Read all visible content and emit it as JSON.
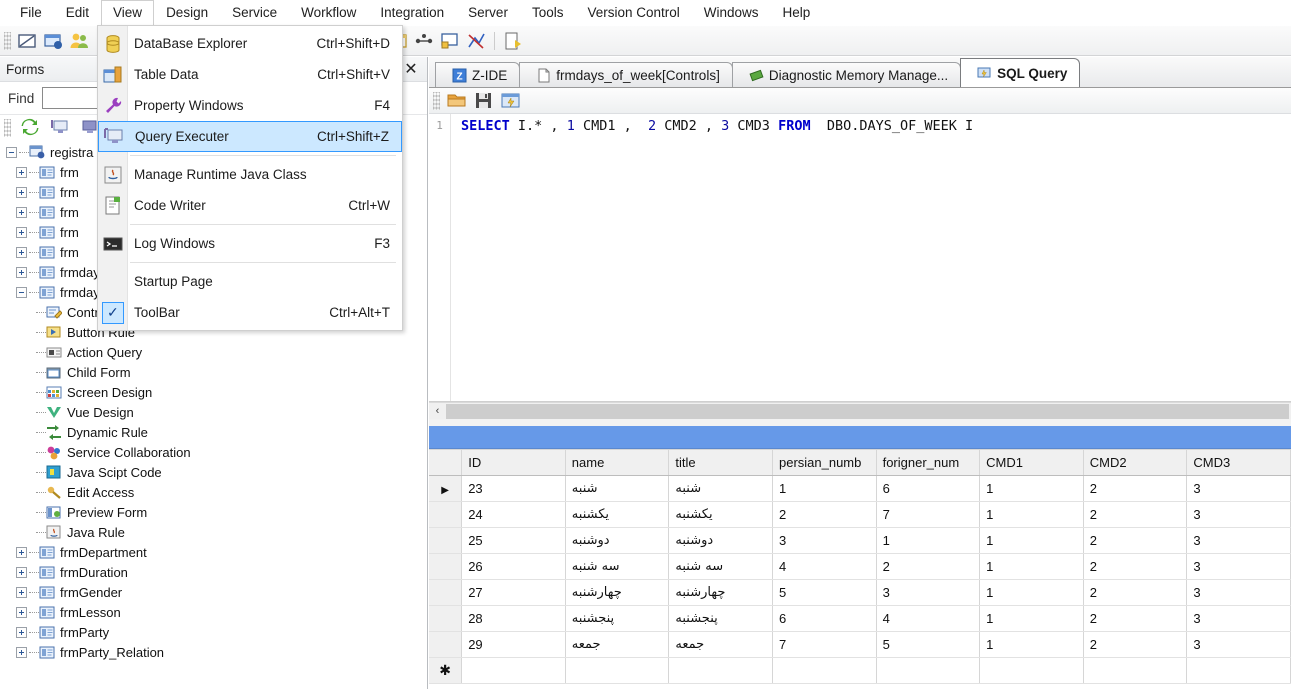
{
  "menubar": {
    "items": [
      {
        "label": "File",
        "open": false
      },
      {
        "label": "Edit",
        "open": false
      },
      {
        "label": "View",
        "open": true
      },
      {
        "label": "Design",
        "open": false
      },
      {
        "label": "Service",
        "open": false
      },
      {
        "label": "Workflow",
        "open": false
      },
      {
        "label": "Integration",
        "open": false
      },
      {
        "label": "Server",
        "open": false
      },
      {
        "label": "Tools",
        "open": false
      },
      {
        "label": "Version Control",
        "open": false
      },
      {
        "label": "Windows",
        "open": false
      },
      {
        "label": "Help",
        "open": false
      }
    ]
  },
  "view_menu": {
    "items": [
      {
        "label": "DataBase Explorer",
        "shortcut": "Ctrl+Shift+D",
        "icon": "database-cylinder-icon",
        "selected": false,
        "separator_after": false
      },
      {
        "label": "Table Data",
        "shortcut": "Ctrl+Shift+V",
        "icon": "table-data-icon",
        "selected": false,
        "separator_after": false
      },
      {
        "label": "Property Windows",
        "shortcut": "F4",
        "icon": "wrench-icon",
        "selected": false,
        "separator_after": false
      },
      {
        "label": "Query Executer",
        "shortcut": "Ctrl+Shift+Z",
        "icon": "query-executer-icon",
        "selected": true,
        "separator_after": true
      },
      {
        "label": "Manage Runtime Java Class",
        "shortcut": "",
        "icon": "java-class-icon",
        "selected": false,
        "separator_after": false
      },
      {
        "label": "Code Writer",
        "shortcut": "Ctrl+W",
        "icon": "code-writer-icon",
        "selected": false,
        "separator_after": true
      },
      {
        "label": "Log Windows",
        "shortcut": "F3",
        "icon": "console-icon",
        "selected": false,
        "separator_after": true
      },
      {
        "label": "Startup Page",
        "shortcut": "",
        "icon": "",
        "selected": false,
        "separator_after": false
      },
      {
        "label": "ToolBar",
        "shortcut": "Ctrl+Alt+T",
        "icon": "checkmark-icon",
        "selected": false,
        "separator_after": false
      }
    ]
  },
  "left_panel": {
    "caption": "Forms",
    "close_label": "✕",
    "find_label": "Find",
    "find_value": "",
    "find_placeholder": "",
    "toolbar_icons": [
      "refresh-icon",
      "query-executer-icon",
      "screen-icon"
    ],
    "tree": {
      "root": {
        "label": "registra",
        "icon": "project-icon",
        "expanded": true
      },
      "children": [
        {
          "label": "frm",
          "icon": "form-icon",
          "expanded": false,
          "depth": 1
        },
        {
          "label": "frm",
          "icon": "form-icon",
          "expanded": false,
          "depth": 1
        },
        {
          "label": "frm",
          "icon": "form-icon",
          "expanded": false,
          "depth": 1
        },
        {
          "label": "frm",
          "icon": "form-icon",
          "expanded": false,
          "depth": 1
        },
        {
          "label": "frm",
          "icon": "form-icon",
          "expanded": false,
          "depth": 1
        },
        {
          "label": "frmdays_of_week",
          "icon": "form-icon",
          "expanded": false,
          "depth": 1
        },
        {
          "label": "frmdays_of_week",
          "icon": "form-icon",
          "expanded": true,
          "depth": 1
        },
        {
          "label": "Controls",
          "icon": "controls-icon",
          "leaf": true,
          "depth": 2
        },
        {
          "label": "Button Rule",
          "icon": "button-rule-icon",
          "leaf": true,
          "depth": 2
        },
        {
          "label": "Action Query",
          "icon": "action-query-icon",
          "leaf": true,
          "depth": 2
        },
        {
          "label": "Child Form",
          "icon": "child-form-icon",
          "leaf": true,
          "depth": 2
        },
        {
          "label": "Screen Design",
          "icon": "screen-design-icon",
          "leaf": true,
          "depth": 2
        },
        {
          "label": "Vue Design",
          "icon": "vue-design-icon",
          "leaf": true,
          "depth": 2
        },
        {
          "label": "Dynamic Rule",
          "icon": "dynamic-rule-icon",
          "leaf": true,
          "depth": 2
        },
        {
          "label": "Service Collaboration",
          "icon": "service-collaboration-icon",
          "leaf": true,
          "depth": 2
        },
        {
          "label": "Java Scipt Code",
          "icon": "java-script-icon",
          "leaf": true,
          "depth": 2
        },
        {
          "label": "Edit Access",
          "icon": "edit-access-icon",
          "leaf": true,
          "depth": 2
        },
        {
          "label": "Preview Form",
          "icon": "preview-form-icon",
          "leaf": true,
          "depth": 2
        },
        {
          "label": "Java Rule",
          "icon": "java-rule-icon",
          "leaf": true,
          "depth": 2
        },
        {
          "label": "frmDepartment",
          "icon": "form-icon",
          "expanded": false,
          "depth": 1
        },
        {
          "label": "frmDuration",
          "icon": "form-icon",
          "expanded": false,
          "depth": 1
        },
        {
          "label": "frmGender",
          "icon": "form-icon",
          "expanded": false,
          "depth": 1
        },
        {
          "label": "frmLesson",
          "icon": "form-icon",
          "expanded": false,
          "depth": 1
        },
        {
          "label": "frmParty",
          "icon": "form-icon",
          "expanded": false,
          "depth": 1
        },
        {
          "label": "frmParty_Relation",
          "icon": "form-icon",
          "expanded": false,
          "depth": 1
        }
      ]
    }
  },
  "editor": {
    "tabs": [
      {
        "label": "Z-IDE",
        "icon": "z-ide-icon",
        "active": false
      },
      {
        "label": "frmdays_of_week[Controls]",
        "icon": "document-icon",
        "active": false
      },
      {
        "label": "Diagnostic Memory Manage...",
        "icon": "memory-icon",
        "active": false
      },
      {
        "label": "SQL Query",
        "icon": "sql-query-icon",
        "active": true
      }
    ],
    "sql_toolbar": [
      "open-folder-icon",
      "save-icon",
      "execute-query-icon"
    ],
    "code": {
      "line_number": "1",
      "tokens": [
        {
          "text": "SELECT",
          "type": "keyword"
        },
        {
          "text": " I.* , ",
          "type": "plain"
        },
        {
          "text": "1",
          "type": "number"
        },
        {
          "text": " CMD1 ,  ",
          "type": "plain"
        },
        {
          "text": "2",
          "type": "number"
        },
        {
          "text": " CMD2 , ",
          "type": "plain"
        },
        {
          "text": "3",
          "type": "number"
        },
        {
          "text": " CMD3 ",
          "type": "plain"
        },
        {
          "text": "FROM",
          "type": "keyword"
        },
        {
          "text": "  DBO.DAYS_OF_WEEK I",
          "type": "plain"
        }
      ],
      "full_text": "SELECT I.* , 1 CMD1 ,  2 CMD2 , 3 CMD3 FROM  DBO.DAYS_OF_WEEK I"
    },
    "scroll_left_arrow": "‹"
  },
  "grid": {
    "columns": [
      "ID",
      "name",
      "title",
      "persian_numb",
      "forigner_num",
      "CMD1",
      "CMD2",
      "CMD3"
    ],
    "selected_row_marker": "▶",
    "new_row_marker": "✱",
    "rows": [
      {
        "selected": true,
        "ID": "23",
        "name": "شنبه",
        "title": "شنبه",
        "persian_numb": "1",
        "forigner_num": "6",
        "CMD1": "1",
        "CMD2": "2",
        "CMD3": "3"
      },
      {
        "selected": false,
        "ID": "24",
        "name": "یکشنبه",
        "title": "یکشنبه",
        "persian_numb": "2",
        "forigner_num": "7",
        "CMD1": "1",
        "CMD2": "2",
        "CMD3": "3"
      },
      {
        "selected": false,
        "ID": "25",
        "name": "دوشنبه",
        "title": "دوشنبه",
        "persian_numb": "3",
        "forigner_num": "1",
        "CMD1": "1",
        "CMD2": "2",
        "CMD3": "3"
      },
      {
        "selected": false,
        "ID": "26",
        "name": "سه شنبه",
        "title": "سه شنبه",
        "persian_numb": "4",
        "forigner_num": "2",
        "CMD1": "1",
        "CMD2": "2",
        "CMD3": "3"
      },
      {
        "selected": false,
        "ID": "27",
        "name": "چهارشنبه",
        "title": "چهارشنبه",
        "persian_numb": "5",
        "forigner_num": "3",
        "CMD1": "1",
        "CMD2": "2",
        "CMD3": "3"
      },
      {
        "selected": false,
        "ID": "28",
        "name": "پنجشنبه",
        "title": "پنجشنبه",
        "persian_numb": "6",
        "forigner_num": "4",
        "CMD1": "1",
        "CMD2": "2",
        "CMD3": "3"
      },
      {
        "selected": false,
        "ID": "29",
        "name": "جمعه",
        "title": "جمعه",
        "persian_numb": "7",
        "forigner_num": "5",
        "CMD1": "1",
        "CMD2": "2",
        "CMD3": "3"
      }
    ]
  },
  "colors": {
    "selection_blue": "#cce8ff",
    "selection_border": "#3399ff",
    "grid_header_bar": "#6699e8",
    "sql_keyword": "#0000cc"
  }
}
